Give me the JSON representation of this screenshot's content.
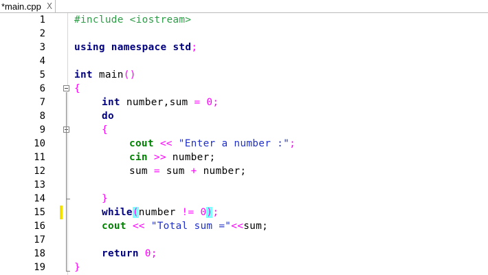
{
  "tab": {
    "title": "*main.cpp",
    "close": "X"
  },
  "lines": [
    {
      "n": "1"
    },
    {
      "n": "2"
    },
    {
      "n": "3"
    },
    {
      "n": "4"
    },
    {
      "n": "5"
    },
    {
      "n": "6"
    },
    {
      "n": "7"
    },
    {
      "n": "8"
    },
    {
      "n": "9"
    },
    {
      "n": "10"
    },
    {
      "n": "11"
    },
    {
      "n": "12"
    },
    {
      "n": "13"
    },
    {
      "n": "14"
    },
    {
      "n": "15"
    },
    {
      "n": "16"
    },
    {
      "n": "17"
    },
    {
      "n": "18"
    },
    {
      "n": "19"
    }
  ],
  "code": {
    "include": "#include <iostream>",
    "using": "using",
    "namespace": "namespace",
    "std": "std",
    "semi": ";",
    "int": "int",
    "main": " main",
    "parens": "()",
    "lbrace": "{",
    "rbrace": "}",
    "decl_rest": " number,sum ",
    "eq": "=",
    "zero": "0",
    "do": "do",
    "cout": "cout",
    "cin": "cin",
    "shl": "<<",
    "shr": ">>",
    "prompt_str": "\"Enter a number :\"",
    "cin_rest": " number;",
    "sum_line": "sum ",
    "plus": "+",
    "sum_rest_a": " sum ",
    "sum_rest_b": " number;",
    "while": "while",
    "lparen": "(",
    "rparen": ")",
    "while_var": "number ",
    "neq": "!=",
    "total_str": "\"Total sum =\"",
    "sum_var": "sum;",
    "return": "return"
  }
}
